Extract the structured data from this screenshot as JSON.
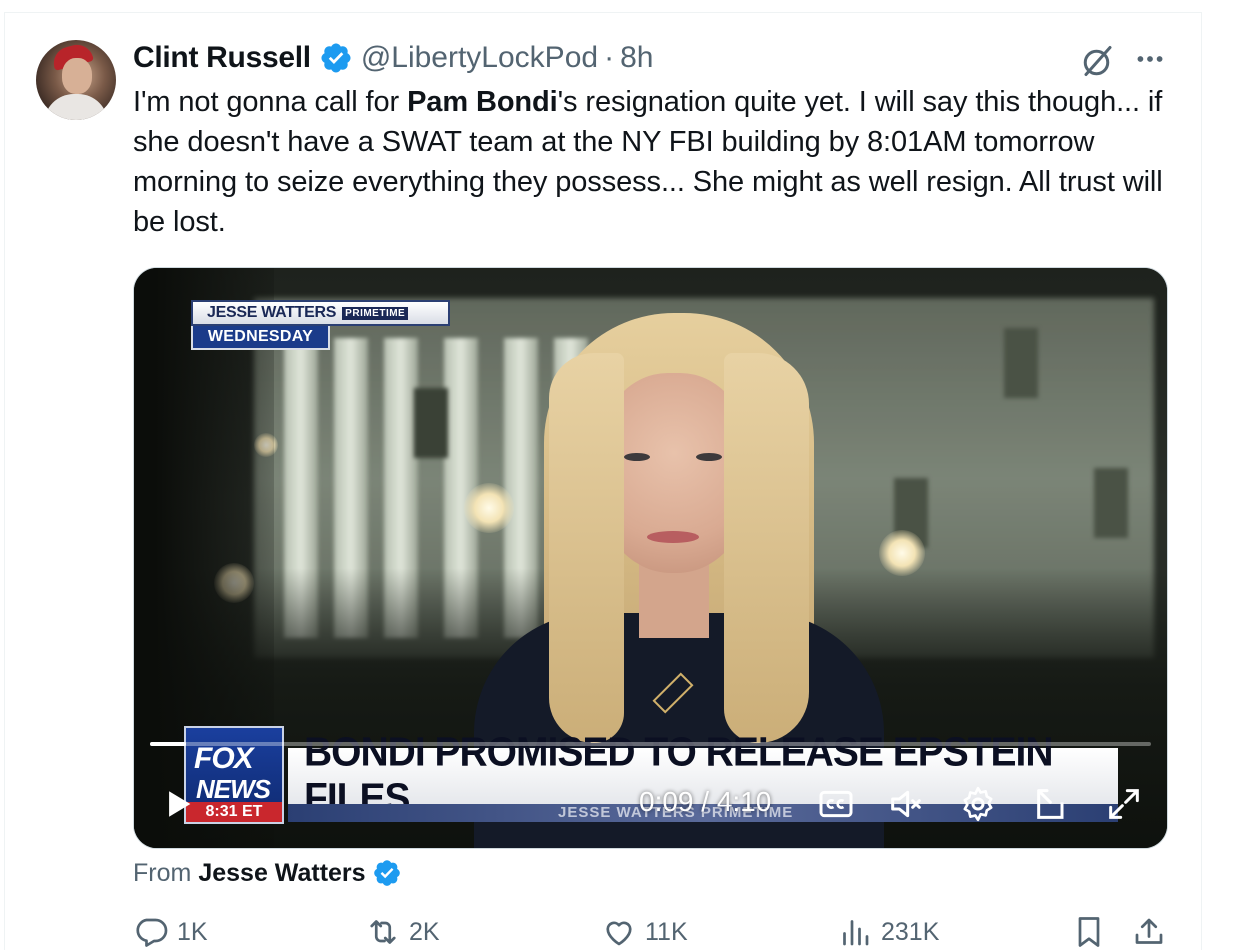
{
  "tweet": {
    "author_name": "Clint Russell",
    "handle": "@LibertyLockPod",
    "separator": "·",
    "time": "8h",
    "text_parts": {
      "p1": "I'm not gonna call for ",
      "bold": "Pam Bondi",
      "p2": "'s resignation quite yet. I will say this though... if she doesn't have a SWAT team at the NY FBI building by 8:01AM tomorrow morning to seize everything they possess... She might as well resign. All trust will be lost."
    }
  },
  "video": {
    "bug_show": "JESSE WATTERS",
    "bug_tag": "PRIMETIME",
    "bug_day": "WEDNESDAY",
    "logo_fox": "FOX",
    "logo_news": "NEWS",
    "logo_time": "8:31 ET",
    "headline": "BONDI PROMISED TO RELEASE EPSTEIN FILES",
    "ticker": "JESSE WATTERS PRIMETIME",
    "time_readout": "0:09 / 4:10",
    "progress_fraction": 0.036
  },
  "source": {
    "prefix": "From",
    "name": "Jesse Watters"
  },
  "actions": {
    "replies": "1K",
    "reposts": "2K",
    "likes": "11K",
    "views": "231K"
  },
  "colors": {
    "verified_blue": "#1d9bf0",
    "muted_text": "#536471",
    "primary_text": "#0f1419"
  },
  "icons": [
    "verified-badge-icon",
    "grok-icon",
    "more-icon",
    "play-icon",
    "captions-icon",
    "mute-icon",
    "settings-icon",
    "pip-icon",
    "fullscreen-icon",
    "reply-icon",
    "repost-icon",
    "like-icon",
    "views-icon",
    "bookmark-icon",
    "share-icon"
  ]
}
